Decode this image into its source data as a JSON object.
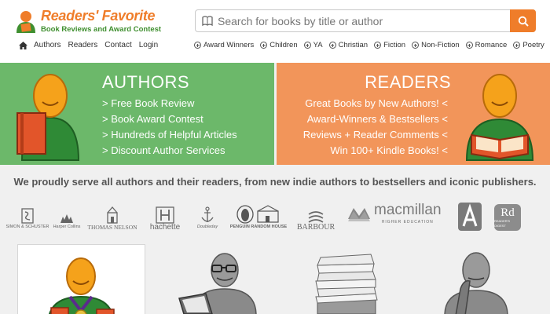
{
  "header": {
    "logo_title": "Readers' Favorite",
    "logo_subtitle": "Book Reviews and Award Contest",
    "search": {
      "placeholder": "Search for books by title or author"
    },
    "nav": [
      "Authors",
      "Readers",
      "Contact",
      "Login"
    ],
    "categories": [
      "Award Winners",
      "Children",
      "YA",
      "Christian",
      "Fiction",
      "Non-Fiction",
      "Romance",
      "Poetry"
    ]
  },
  "authors_banner": {
    "title": "AUTHORS",
    "items": [
      "> Free Book Review",
      "> Book Award Contest",
      "> Hundreds of Helpful Articles",
      "> Discount Author Services"
    ]
  },
  "readers_banner": {
    "title": "READERS",
    "items": [
      "Great Books by New Authors! <",
      "Award-Winners & Bestsellers <",
      "Reviews + Reader Comments <",
      "Win 100+ Kindle Books! <"
    ]
  },
  "tagline": "We proudly serve all authors and their readers, from new indie authors to bestsellers and iconic publishers.",
  "publishers": {
    "simon": "SIMON & SCHUSTER",
    "harper": "Harper Collins",
    "nelson": "THOMAS NELSON",
    "hachette": "hachette",
    "doubleday": "Doubleday",
    "penguin": "PENGUIN RANDOM HOUSE",
    "barbour": "BARBOUR",
    "macmillan": "macmillan",
    "macmillan_sub": "HIGHER EDUCATION",
    "rd": "Rd",
    "rd_sub": "READER'S DIGEST"
  },
  "colors": {
    "orange": "#ef7d2a",
    "green": "#6cb86a",
    "salmon": "#f2955a",
    "logo_green": "#3f8f2f"
  }
}
